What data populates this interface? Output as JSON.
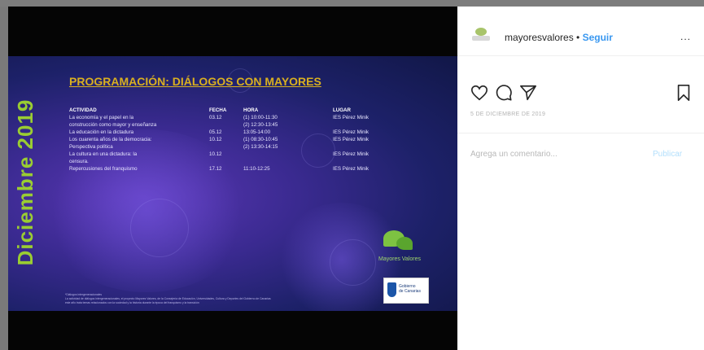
{
  "post": {
    "slide": {
      "vertical_title": "Diciembre 2019",
      "heading": "PROGRAMACIÓN: DIÁLOGOS CON MAYORES",
      "table": {
        "headers": [
          "ACTIVIDAD",
          "FECHA",
          "HORA",
          "LUGAR"
        ],
        "rows": [
          [
            "La economía y el papel en la",
            "03.12",
            "(1) 10:00-11:30",
            "IES Pérez Minik"
          ],
          [
            "construcción como mayor y enseñanza",
            "",
            "(2) 12:30-13:45",
            ""
          ],
          [
            "La educación en la dictadura",
            "05.12",
            "13:05-14:00",
            "IES Pérez Minik"
          ],
          [
            "Los cuarenta años de la democracia:",
            "10.12",
            "(1) 08:30-10:45",
            "IES Pérez Minik"
          ],
          [
            "Perspectiva política",
            "",
            "(2) 13:30-14:15",
            ""
          ],
          [
            "La cultura en una dictadura: la",
            "10.12",
            "",
            "IES Pérez Minik"
          ],
          [
            "censura.",
            "",
            "",
            ""
          ],
          [
            "Repercusiones del franquismo",
            "17.12",
            "11:10-12:25",
            "IES Pérez Minik"
          ]
        ]
      },
      "logo_text": "Mayores Valores",
      "gov_text": [
        "Gobierno",
        "de Canarias"
      ],
      "footer": [
        "*Diálogos intergeneracionales",
        "La actividad de diálogos intergeneracionales, el proyecto Mayores Valores, de la Consejería de Educación, Universidades, Cultura y Deportes del Gobierno de Canarias",
        "este año trata temas relacionados con la sociedad y la historia durante la época del franquismo y la transición"
      ]
    }
  },
  "sidebar": {
    "username": "mayoresvalores",
    "separator": "•",
    "follow_label": "Seguir",
    "more_label": "...",
    "date": "5 DE DICIEMBRE DE 2019",
    "comment_placeholder": "Agrega un comentario...",
    "publish_label": "Publicar"
  },
  "icons": [
    "heart-icon",
    "comment-icon",
    "share-icon",
    "bookmark-icon",
    "more-icon"
  ],
  "colors": {
    "accent": "#3897f0",
    "publish_disabled": "#b2dffc",
    "title_green": "#9acd32",
    "heading_gold": "#d9b020"
  }
}
